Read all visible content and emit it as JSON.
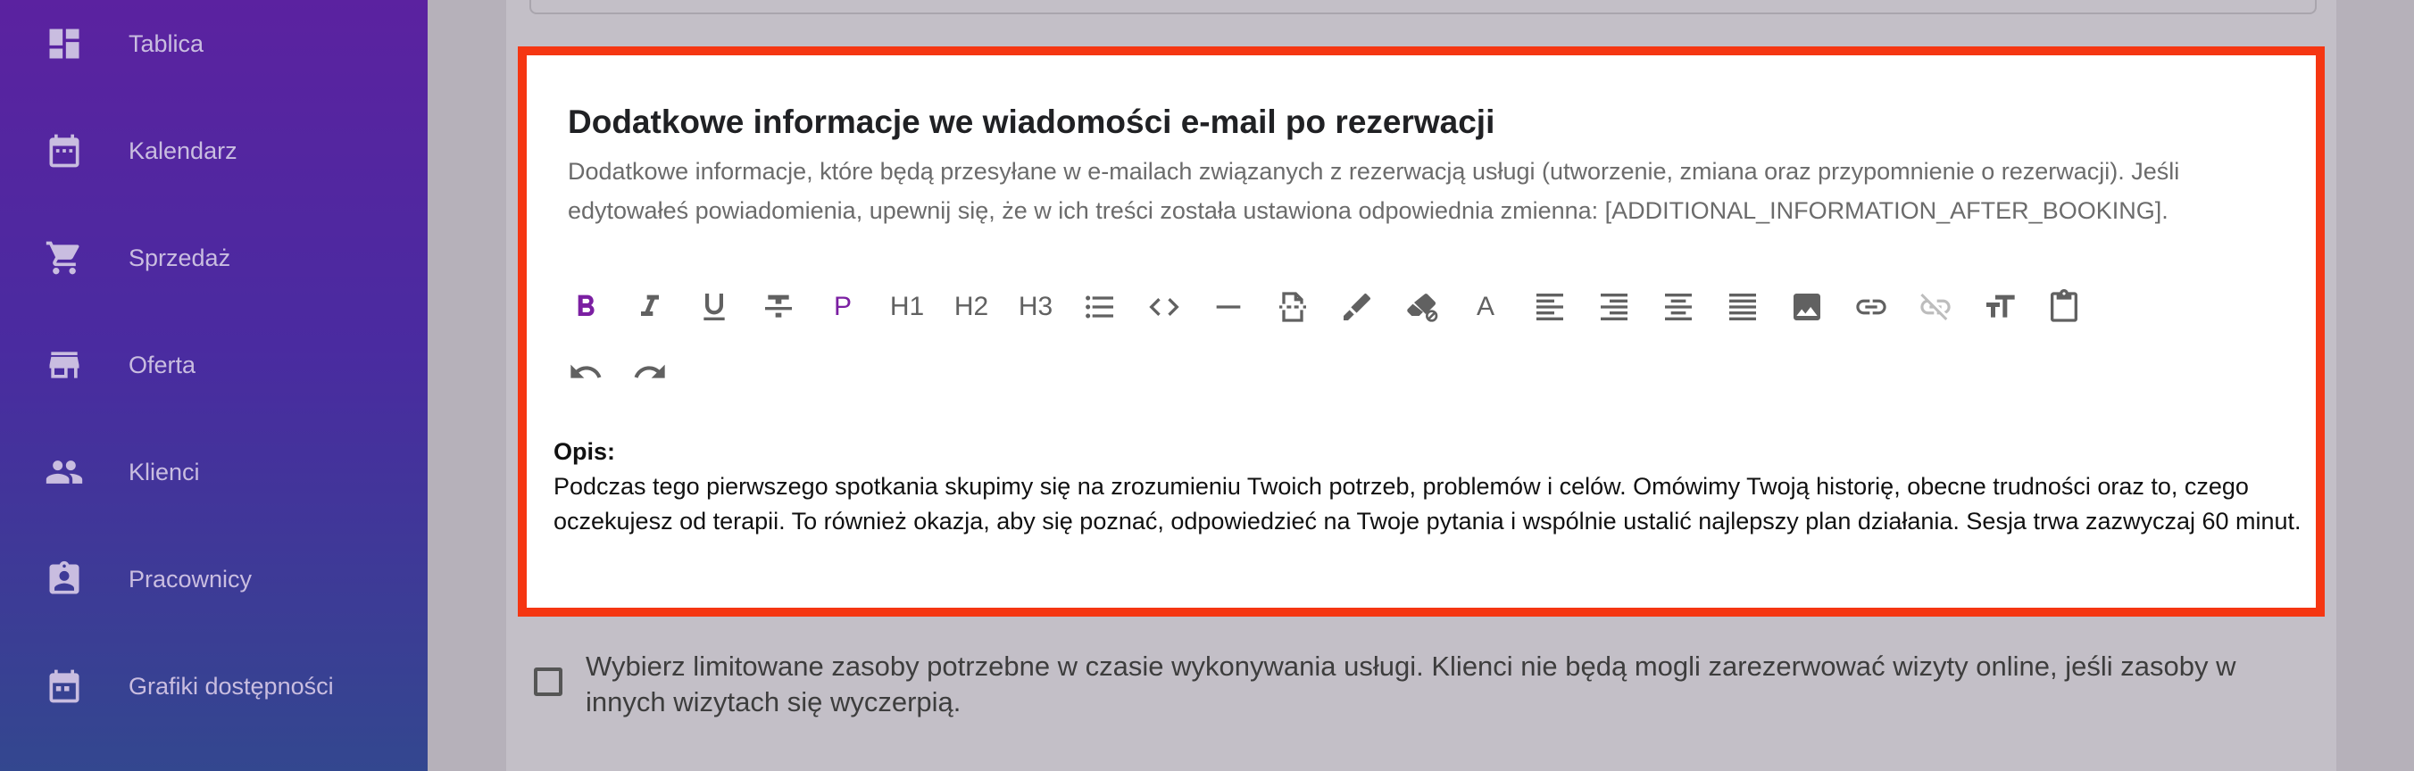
{
  "sidebar": {
    "items": [
      {
        "label": "Tablica",
        "icon": "dashboard-icon"
      },
      {
        "label": "Kalendarz",
        "icon": "calendar-icon"
      },
      {
        "label": "Sprzedaż",
        "icon": "cart-icon"
      },
      {
        "label": "Oferta",
        "icon": "store-icon"
      },
      {
        "label": "Klienci",
        "icon": "people-icon"
      },
      {
        "label": "Pracownicy",
        "icon": "badge-icon"
      },
      {
        "label": "Grafiki dostępności",
        "icon": "event-schedule-icon"
      }
    ]
  },
  "section": {
    "title": "Dodatkowe informacje we wiadomości e-mail po rezerwacji",
    "description": "Dodatkowe informacje, które będą przesyłane w e-mailach związanych z rezerwacją usługi (utworzenie, zmiana oraz przypomnienie o rezerwacji). Jeśli edytowałeś powiadomienia, upewnij się, że w ich treści została ustawiona odpowiednia zmienna: [ADDITIONAL_INFORMATION_AFTER_BOOKING]."
  },
  "toolbar": {
    "paragraph": "P",
    "h1": "H1",
    "h2": "H2",
    "h3": "H3",
    "text_color": "A",
    "active_color": "#7b1fa2"
  },
  "editor": {
    "label": "Opis:",
    "body": "Podczas tego pierwszego spotkania skupimy się na zrozumieniu Twoich potrzeb, problemów i celów. Omówimy Twoją historię, obecne trudności oraz to, czego oczekujesz od terapii. To również okazja, aby się poznać, odpowiedzieć na Twoje pytania i wspólnie ustalić najlepszy plan działania. Sesja trwa zazwyczaj 60 minut."
  },
  "resources": {
    "checked": false,
    "label": "Wybierz limitowane zasoby potrzebne w czasie wykonywania usługi. Klienci nie będą mogli zarezerwować wizyty online, jeśli zasoby w innych wizytach się wyczerpią."
  },
  "colors": {
    "highlight_border": "#f53612",
    "sidebar_top": "#5b22a0",
    "sidebar_bottom": "#33478f"
  }
}
